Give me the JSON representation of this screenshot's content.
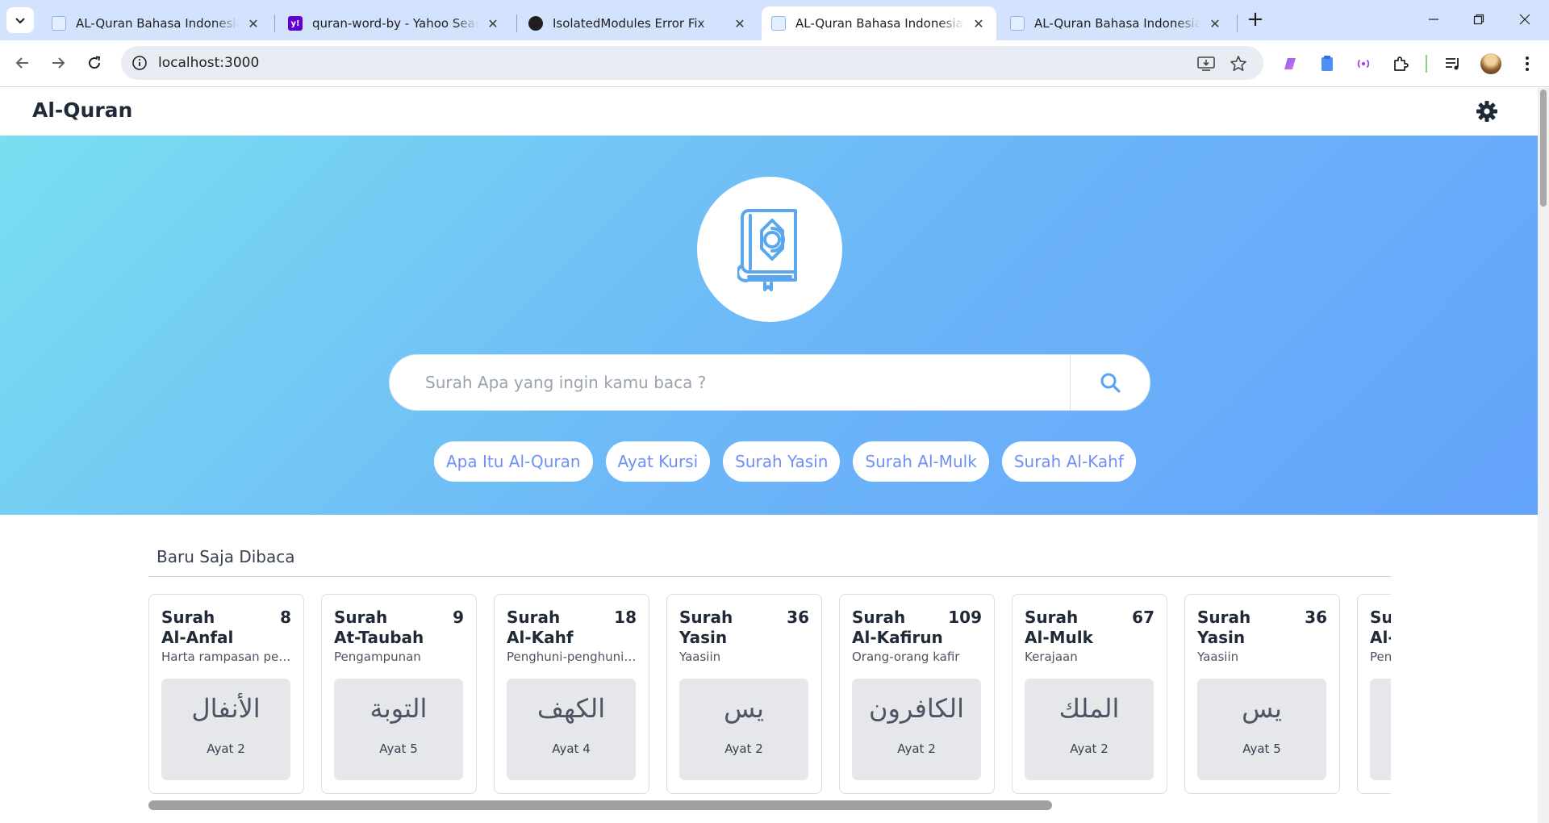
{
  "browser": {
    "tabs": [
      {
        "title": "AL-Quran Bahasa Indonesia - Q",
        "active": false
      },
      {
        "title": "quran-word-by - Yahoo Search",
        "active": false
      },
      {
        "title": "IsolatedModules Error Fix",
        "active": false
      },
      {
        "title": "AL-Quran Bahasa Indonesia - Q",
        "active": true
      },
      {
        "title": "AL-Quran Bahasa Indonesia - Q",
        "active": false
      }
    ],
    "url": "localhost:3000"
  },
  "site": {
    "logo": "Al-Quran"
  },
  "hero": {
    "search_placeholder": "Surah Apa yang ingin kamu baca ?",
    "chips": [
      "Apa Itu Al-Quran",
      "Ayat Kursi",
      "Surah Yasin",
      "Surah Al-Mulk",
      "Surah Al-Kahf"
    ]
  },
  "recent": {
    "title": "Baru Saja Dibaca",
    "cards": [
      {
        "surah": "Surah",
        "name": "Al-Anfal",
        "number": "8",
        "meaning": "Harta rampasan perang",
        "arabic": "الأنفال",
        "ayat": "Ayat 2"
      },
      {
        "surah": "Surah",
        "name": "At-Taubah",
        "number": "9",
        "meaning": "Pengampunan",
        "arabic": "التوبة",
        "ayat": "Ayat 5"
      },
      {
        "surah": "Surah",
        "name": "Al-Kahf",
        "number": "18",
        "meaning": "Penghuni-penghuni gua",
        "arabic": "الكهف",
        "ayat": "Ayat 4"
      },
      {
        "surah": "Surah",
        "name": "Yasin",
        "number": "36",
        "meaning": "Yaasiin",
        "arabic": "يس",
        "ayat": "Ayat 2"
      },
      {
        "surah": "Surah",
        "name": "Al-Kafirun",
        "number": "109",
        "meaning": "Orang-orang kafir",
        "arabic": "الكافرون",
        "ayat": "Ayat 2"
      },
      {
        "surah": "Surah",
        "name": "Al-Mulk",
        "number": "67",
        "meaning": "Kerajaan",
        "arabic": "الملك",
        "ayat": "Ayat 2"
      },
      {
        "surah": "Surah",
        "name": "Yasin",
        "number": "36",
        "meaning": "Yaasiin",
        "arabic": "يس",
        "ayat": "Ayat 5"
      },
      {
        "surah": "Su",
        "name": "Al-",
        "number": "",
        "meaning": "Pen",
        "arabic": "",
        "ayat": ""
      }
    ]
  },
  "colors": {
    "tabbar": "#d3e3fd",
    "hero_start": "#7adff1",
    "hero_end": "#63a3fb",
    "chip_text": "#6f8ff7",
    "accent": "#56a4f2"
  }
}
